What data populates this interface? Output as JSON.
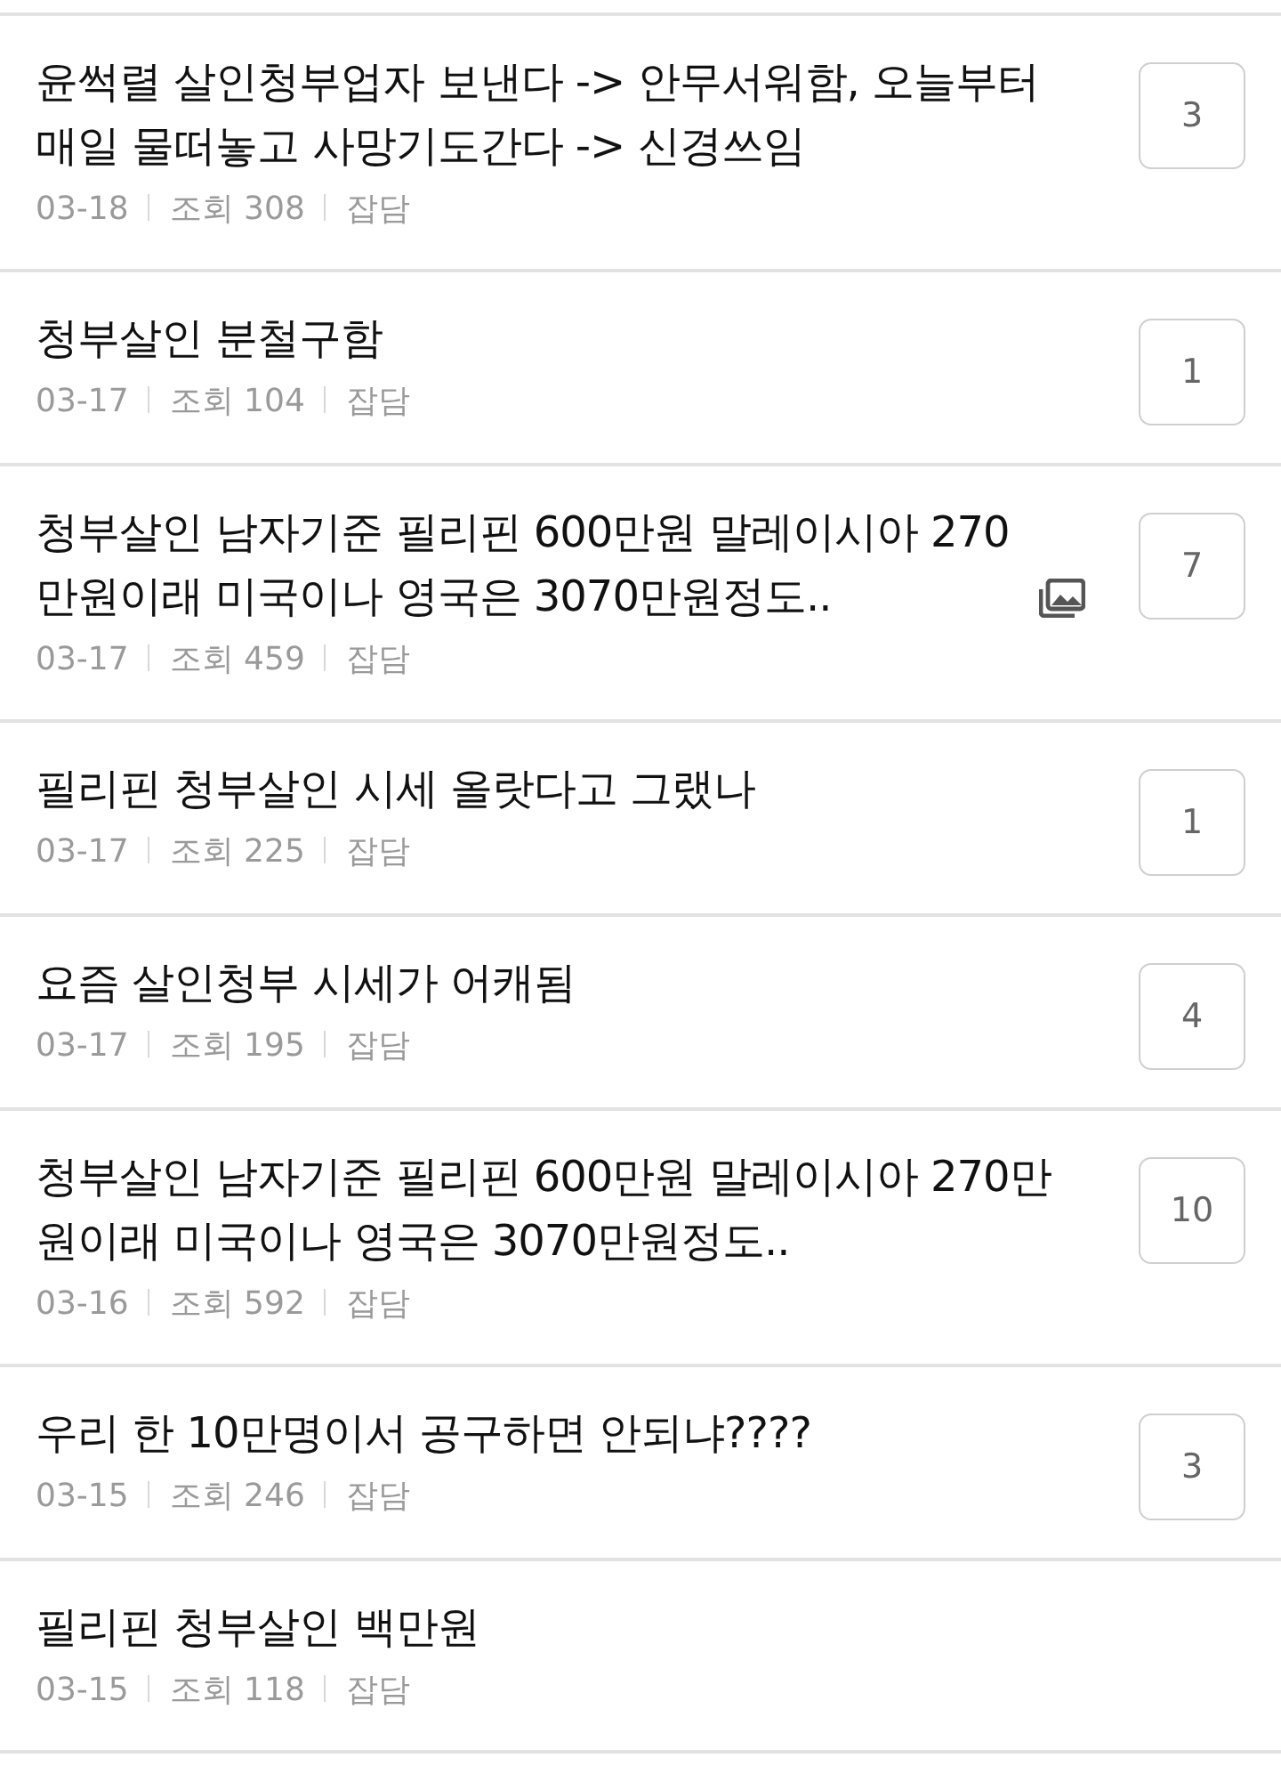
{
  "posts": [
    {
      "title": "윤썩렬 살인청부업자 보낸다 -> 안무서워함, 오늘부터 매일 물떠놓고 사망기도간다 -> 신경쓰임",
      "has_image": false,
      "date": "03-18",
      "views_label": "조회",
      "views": "308",
      "category": "잡담",
      "comments": "3"
    },
    {
      "title": "청부살인 분철구함",
      "has_image": false,
      "date": "03-17",
      "views_label": "조회",
      "views": "104",
      "category": "잡담",
      "comments": "1"
    },
    {
      "title": "청부살인 남자기준 필리핀 600만원 말레이시아 270만원이래 미국이나 영국은 3070만원정도..",
      "has_image": true,
      "date": "03-17",
      "views_label": "조회",
      "views": "459",
      "category": "잡담",
      "comments": "7"
    },
    {
      "title": "필리핀 청부살인 시세 올랏다고 그랬나",
      "has_image": false,
      "date": "03-17",
      "views_label": "조회",
      "views": "225",
      "category": "잡담",
      "comments": "1"
    },
    {
      "title": "요즘 살인청부 시세가 어캐됨",
      "has_image": false,
      "date": "03-17",
      "views_label": "조회",
      "views": "195",
      "category": "잡담",
      "comments": "4"
    },
    {
      "title": "청부살인 남자기준 필리핀 600만원 말레이시아 270만원이래 미국이나 영국은 3070만원정도..",
      "has_image": false,
      "date": "03-16",
      "views_label": "조회",
      "views": "592",
      "category": "잡담",
      "comments": "10"
    },
    {
      "title": "우리 한 10만명이서 공구하면 안되냐????",
      "has_image": false,
      "date": "03-15",
      "views_label": "조회",
      "views": "246",
      "category": "잡담",
      "comments": "3"
    },
    {
      "title": "필리핀 청부살인 백만원",
      "has_image": false,
      "date": "03-15",
      "views_label": "조회",
      "views": "118",
      "category": "잡담"
    }
  ]
}
